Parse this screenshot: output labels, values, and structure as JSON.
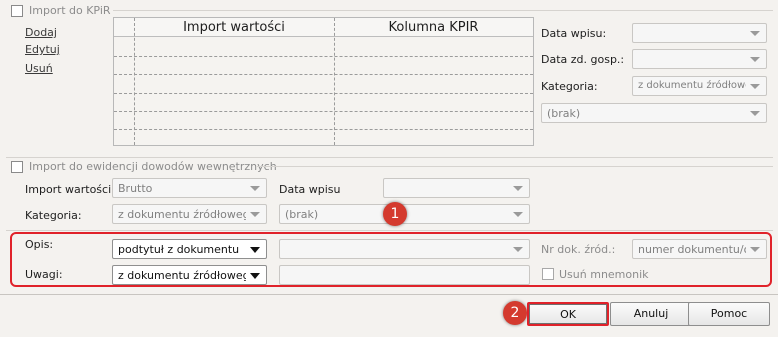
{
  "import_kpir": {
    "checkbox_label": "Import do KPiR",
    "links": {
      "add": "Dodaj",
      "edit": "Edytuj",
      "delete": "Usuń"
    },
    "table": {
      "columns": [
        "Import wartości",
        "Kolumna KPIR"
      ]
    },
    "data_wpisu_label": "Data wpisu:",
    "data_wpisu_value": "",
    "data_zd_label": "Data zd. gosp.:",
    "data_zd_value": "",
    "kategoria_label": "Kategoria:",
    "kategoria_value": "z dokumentu źródłowego",
    "brak_value": "(brak)"
  },
  "import_ewidencji": {
    "checkbox_label": "Import do ewidencji dowodów wewnętrznych",
    "import_wartosci_label": "Import wartości:",
    "import_wartosci_value": "Brutto",
    "data_wpisu_label": "Data wpisu",
    "data_wpisu_value": "",
    "kategoria_label": "Kategoria:",
    "kategoria_value": "z dokumentu źródłowego",
    "brak_value": "(brak)"
  },
  "opis": {
    "label": "Opis:",
    "value": "podtytuł z dokumentu",
    "second_value": "",
    "nr_dok_label": "Nr dok. źród.:",
    "nr_dok_value": "numer dokumentu/oryg"
  },
  "uwagi": {
    "label": "Uwagi:",
    "value": "z dokumentu źródłowego",
    "text_value": "",
    "usun_mnemonik_label": "Usuń mnemonik"
  },
  "buttons": {
    "ok": "OK",
    "cancel": "Anuluj",
    "help": "Pomoc"
  },
  "badges": {
    "first": "1",
    "second": "2"
  },
  "colors": {
    "highlight": "#e0222a",
    "badge": "#d43a2e"
  }
}
